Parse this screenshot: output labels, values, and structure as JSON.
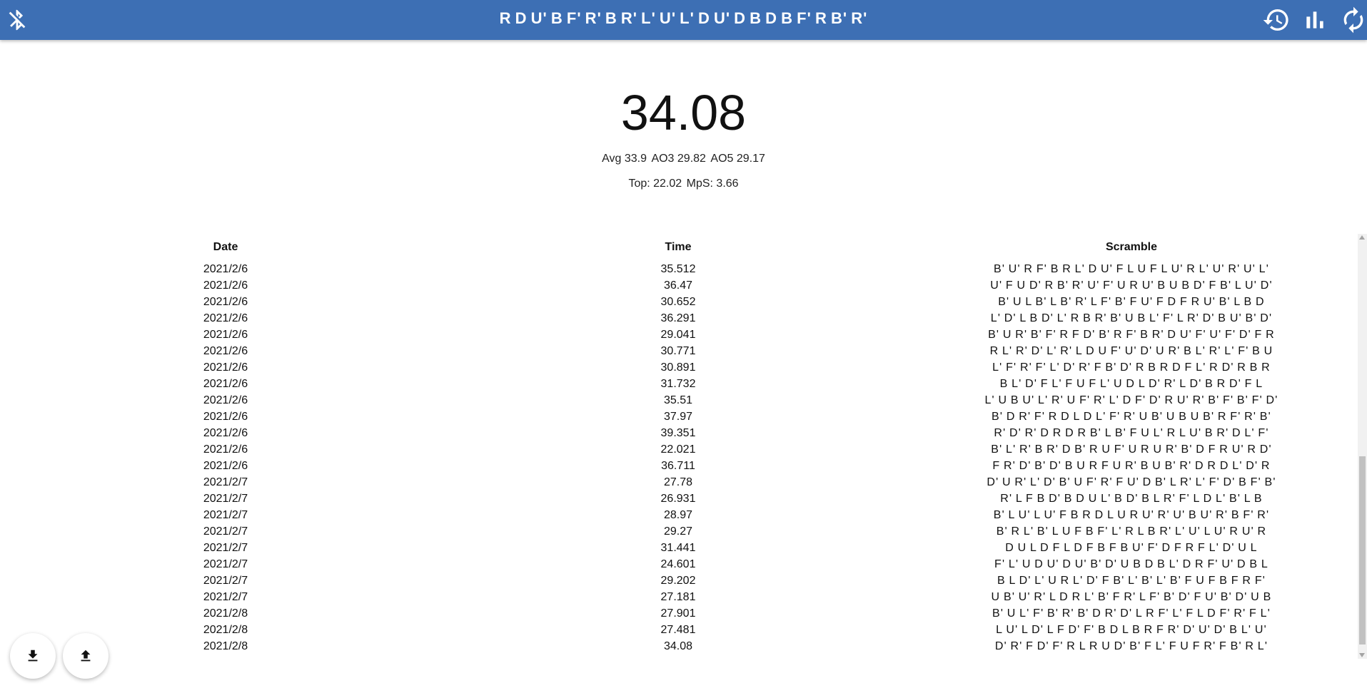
{
  "header": {
    "scramble": "R D U' B F' R' B R' L' U' L' D U' D B D B F' R B' R'",
    "icons": {
      "bluetooth": "bluetooth-disabled-icon",
      "history": "history-icon",
      "stats": "bar-chart-icon",
      "reset": "refresh-icon"
    },
    "color": "#3d6fb4"
  },
  "timer": {
    "value": "34.08"
  },
  "stats": {
    "line1": [
      "Avg 33.9",
      "AO3 29.82",
      "AO5 29.17"
    ],
    "line2": [
      "Top: 22.02",
      "MpS: 3.66"
    ]
  },
  "table": {
    "headers": [
      "Date",
      "Time",
      "Scramble"
    ],
    "rows": [
      {
        "date": "2021/2/6",
        "time": "35.512",
        "scramble": "B' U' R F' B R L' D U' F L U F L U' R L' U' R' U' L'"
      },
      {
        "date": "2021/2/6",
        "time": "36.47",
        "scramble": "U' F U D' R B' R' U' F' U R U' B U B D' F B' L U' D'"
      },
      {
        "date": "2021/2/6",
        "time": "30.652",
        "scramble": "B' U L B' L B' R' L F' B' F U' F D F R U' B' L B D"
      },
      {
        "date": "2021/2/6",
        "time": "36.291",
        "scramble": "L' D' L B D' L' R B R' B' U B L' F' L R' D' B U' B' D'"
      },
      {
        "date": "2021/2/6",
        "time": "29.041",
        "scramble": "B' U R' B' F' R F D' B' R F' B R' D U' F' U' F' D' F R"
      },
      {
        "date": "2021/2/6",
        "time": "30.771",
        "scramble": "R L' R' D' L' R' L D U F' U' D' U R' B L' R' L' F' B U"
      },
      {
        "date": "2021/2/6",
        "time": "30.891",
        "scramble": "L' F' R' F' L' D' R' F B' D' R B R D F L' R D' R B R"
      },
      {
        "date": "2021/2/6",
        "time": "31.732",
        "scramble": "B L' D' F L' F U F L' U D L D' R' L D' B R D' F L"
      },
      {
        "date": "2021/2/6",
        "time": "35.51",
        "scramble": "L' U B U' L' R' U F' R' L' D F' D' R U' R' B' F' B' F' D'"
      },
      {
        "date": "2021/2/6",
        "time": "37.97",
        "scramble": "B' D R' F' R D L D L' F' R' U B' U B U B' R F' R' B'"
      },
      {
        "date": "2021/2/6",
        "time": "39.351",
        "scramble": "R' D' R' D R D R B' L B' F U L' R L U' B R' D L' F'"
      },
      {
        "date": "2021/2/6",
        "time": "22.021",
        "scramble": "B' L' R' B R' D B' R U F' U R U R' B' D F R U' R D'"
      },
      {
        "date": "2021/2/6",
        "time": "36.711",
        "scramble": "F R' D' B' D' B U R F U R' B U B' R' D R D L' D' R"
      },
      {
        "date": "2021/2/7",
        "time": "27.78",
        "scramble": "D' U R' L' D' B' U F' R' F U' D B' L R' L' F' D' B F' B'"
      },
      {
        "date": "2021/2/7",
        "time": "26.931",
        "scramble": "R' L F B D' B D U L' B D' B L R' F' L D L' B' L B"
      },
      {
        "date": "2021/2/7",
        "time": "28.97",
        "scramble": "B' L U' L U' F B R D L U R U' R' U' B U' R' B F' R'"
      },
      {
        "date": "2021/2/7",
        "time": "29.27",
        "scramble": "B' R L' B' L U F B F' L' R L B R' L' U' L U' R U' R"
      },
      {
        "date": "2021/2/7",
        "time": "31.441",
        "scramble": "D U L D F L D F B F B U' F' D F R F L' D' U L"
      },
      {
        "date": "2021/2/7",
        "time": "24.601",
        "scramble": "F' L' U D U' D U' B' D' U B D B L' D R F' U' D B L"
      },
      {
        "date": "2021/2/7",
        "time": "29.202",
        "scramble": "B L D' L' U R L' D' F B' L' B' L' B' F U F B F R F'"
      },
      {
        "date": "2021/2/7",
        "time": "27.181",
        "scramble": "U B' U' R' L D R L' B' F R' L F' B' D' F U' B' D' U B"
      },
      {
        "date": "2021/2/8",
        "time": "27.901",
        "scramble": "B' U L' F' B' R' B' D R' D' L R F' L' F L D F' R' F L'"
      },
      {
        "date": "2021/2/8",
        "time": "27.481",
        "scramble": "L U' L D' L F D' F' B D L B R F R' D' U' D' B L' U'"
      },
      {
        "date": "2021/2/8",
        "time": "34.08",
        "scramble": "D' R' F D' F' R L R U D' B' F L' F U F R' F B' R L'"
      }
    ]
  },
  "fabs": {
    "download": "download-icon",
    "upload": "upload-icon"
  }
}
